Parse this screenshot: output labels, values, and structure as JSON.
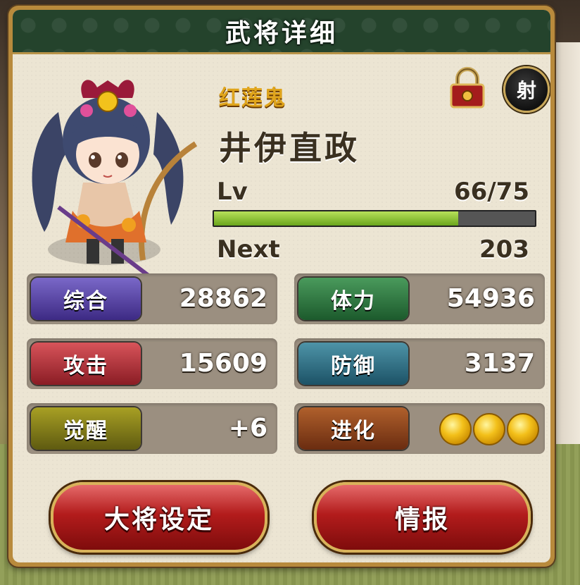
{
  "title": "武将详细",
  "general": {
    "subtitle": "红莲鬼",
    "name": "井伊直政",
    "class_label": "射",
    "lock_icon": "lock-icon"
  },
  "level": {
    "label": "Lv",
    "value": "66/75",
    "progress_fraction": 0.76,
    "next_label": "Next",
    "next_value": "203"
  },
  "stats": {
    "total": {
      "label": "综合",
      "value": "28862"
    },
    "stamina": {
      "label": "体力",
      "value": "54936"
    },
    "attack": {
      "label": "攻击",
      "value": "15609"
    },
    "defense": {
      "label": "防御",
      "value": "3137"
    },
    "awaken": {
      "label": "觉醒",
      "value": "+6"
    },
    "evolve": {
      "label": "进化",
      "stars": 3
    }
  },
  "buttons": {
    "set_leader": "大将设定",
    "info": "情报"
  }
}
